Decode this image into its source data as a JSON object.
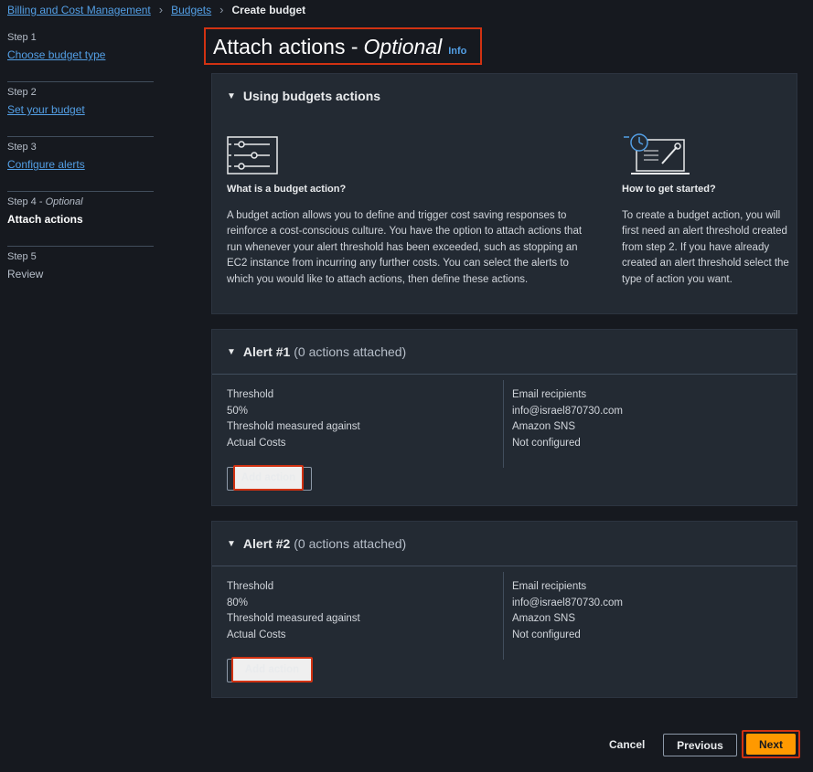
{
  "breadcrumb": {
    "item1": "Billing and Cost Management",
    "item2": "Budgets",
    "current": "Create budget"
  },
  "steps": [
    {
      "num": "Step 1",
      "label": "Choose budget type"
    },
    {
      "num": "Step 2",
      "label": "Set your budget"
    },
    {
      "num": "Step 3",
      "label": "Configure alerts"
    },
    {
      "num": "Step 4",
      "optional": "Optional",
      "label": "Attach actions"
    },
    {
      "num": "Step 5",
      "label": "Review"
    }
  ],
  "title": {
    "main": "Attach actions -",
    "optional": "Optional",
    "info": "Info"
  },
  "using": {
    "heading": "Using budgets actions",
    "left_title": "What is a budget action?",
    "left_text": "A budget action allows you to define and trigger cost saving responses to reinforce a cost-conscious culture. You have the option to attach actions that run whenever your alert threshold has been exceeded, such as stopping an EC2 instance from incurring any further costs. You can select the alerts to which you would like to attach actions, then define these actions.",
    "right_title": "How to get started?",
    "right_text": "To create a budget action, you will first need an alert threshold created from step 2. If you have already created an alert threshold select the type of action you want."
  },
  "alerts": [
    {
      "title": "Alert #1",
      "attached": "(0 actions attached)",
      "threshold_label": "Threshold",
      "threshold_value": "50%",
      "measured_label": "Threshold measured against",
      "measured_value": "Actual Costs",
      "email_label": "Email recipients",
      "email_value": "info@israel870730.com",
      "sns_label": "Amazon SNS",
      "sns_value": "Not configured",
      "button": "Add action"
    },
    {
      "title": "Alert #2",
      "attached": "(0 actions attached)",
      "threshold_label": "Threshold",
      "threshold_value": "80%",
      "measured_label": "Threshold measured against",
      "measured_value": "Actual Costs",
      "email_label": "Email recipients",
      "email_value": "info@israel870730.com",
      "sns_label": "Amazon SNS",
      "sns_value": "Not configured",
      "button": "Add action"
    }
  ],
  "footer": {
    "cancel": "Cancel",
    "previous": "Previous",
    "next": "Next"
  },
  "icons": {
    "left_illustration": "sliders-icon",
    "right_illustration": "laptop-wrench-clock-icon",
    "caret": "caret-down-icon"
  },
  "colors": {
    "background": "#16191f",
    "panel": "#232a33",
    "link": "#539fe5",
    "primary": "#ff9900",
    "highlight": "#d13212"
  }
}
